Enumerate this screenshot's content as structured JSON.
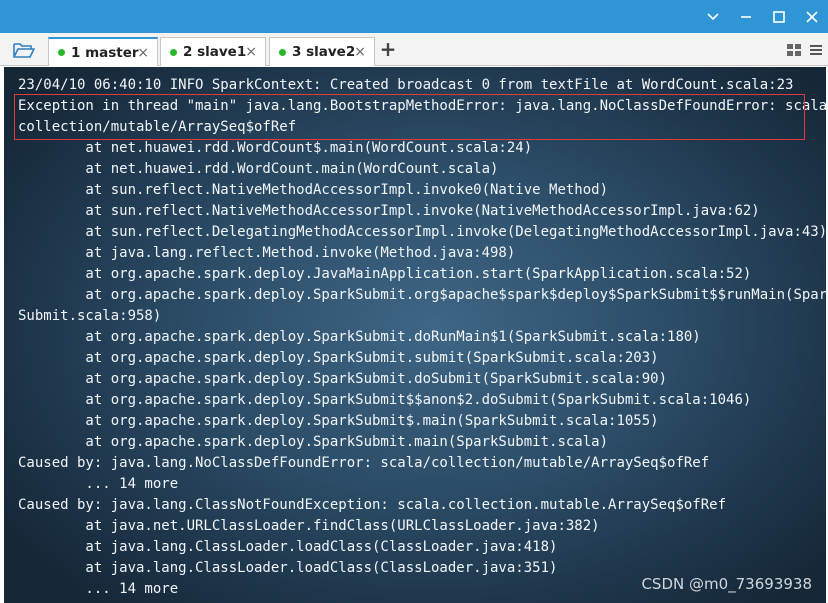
{
  "window": {
    "accent_color": "#2f95d4",
    "controls": {
      "collapse_icon": "chevron-down-icon",
      "restore_icon": "restore-icon",
      "maximize_icon": "maximize-icon",
      "close_icon": "close-icon"
    }
  },
  "tabbar": {
    "open_icon": "folder-open-icon",
    "tabs": [
      {
        "label": "1 master",
        "status_color": "#2ab52a",
        "active": true
      },
      {
        "label": "2 slave1",
        "status_color": "#2ab52a",
        "active": false
      },
      {
        "label": "3 slave2",
        "status_color": "#2ab52a",
        "active": false
      }
    ],
    "tab_close_glyph": "×",
    "add_tab_glyph": "+",
    "layout_icon": "grid-layout-icon",
    "menu_icon": "menu-icon"
  },
  "terminal": {
    "lines": [
      "23/04/10 06:40:10 INFO SparkContext: Created broadcast 0 from textFile at WordCount.scala:23",
      "Exception in thread \"main\" java.lang.BootstrapMethodError: java.lang.NoClassDefFoundError: scala/",
      "collection/mutable/ArraySeq$ofRef",
      "        at net.huawei.rdd.WordCount$.main(WordCount.scala:24)",
      "        at net.huawei.rdd.WordCount.main(WordCount.scala)",
      "        at sun.reflect.NativeMethodAccessorImpl.invoke0(Native Method)",
      "        at sun.reflect.NativeMethodAccessorImpl.invoke(NativeMethodAccessorImpl.java:62)",
      "        at sun.reflect.DelegatingMethodAccessorImpl.invoke(DelegatingMethodAccessorImpl.java:43)",
      "        at java.lang.reflect.Method.invoke(Method.java:498)",
      "        at org.apache.spark.deploy.JavaMainApplication.start(SparkApplication.scala:52)",
      "        at org.apache.spark.deploy.SparkSubmit.org$apache$spark$deploy$SparkSubmit$$runMain(Spark",
      "Submit.scala:958)",
      "        at org.apache.spark.deploy.SparkSubmit.doRunMain$1(SparkSubmit.scala:180)",
      "        at org.apache.spark.deploy.SparkSubmit.submit(SparkSubmit.scala:203)",
      "        at org.apache.spark.deploy.SparkSubmit.doSubmit(SparkSubmit.scala:90)",
      "        at org.apache.spark.deploy.SparkSubmit$$anon$2.doSubmit(SparkSubmit.scala:1046)",
      "        at org.apache.spark.deploy.SparkSubmit$.main(SparkSubmit.scala:1055)",
      "        at org.apache.spark.deploy.SparkSubmit.main(SparkSubmit.scala)",
      "Caused by: java.lang.NoClassDefFoundError: scala/collection/mutable/ArraySeq$ofRef",
      "        ... 14 more",
      "Caused by: java.lang.ClassNotFoundException: scala.collection.mutable.ArraySeq$ofRef",
      "        at java.net.URLClassLoader.findClass(URLClassLoader.java:382)",
      "        at java.lang.ClassLoader.loadClass(ClassLoader.java:418)",
      "        at java.lang.ClassLoader.loadClass(ClassLoader.java:351)",
      "        ... 14 more"
    ],
    "highlight_color": "#e03a3a",
    "watermark": "CSDN @m0_73693938"
  }
}
